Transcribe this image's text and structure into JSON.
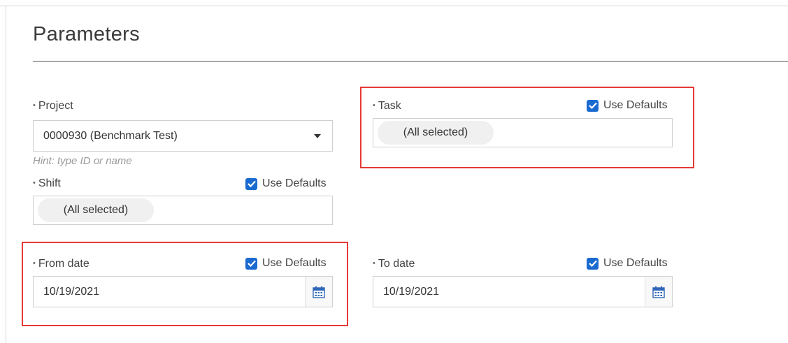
{
  "page": {
    "title": "Parameters"
  },
  "colors": {
    "accent": "#1b6ad0",
    "highlight": "#e53935",
    "rule": "#a9a9a9"
  },
  "icons": {
    "checkbox": "checkbox-checked-icon",
    "dropdown": "caret-down-icon",
    "calendar": "calendar-icon"
  },
  "form": {
    "required_marker": "•",
    "project": {
      "label": "Project",
      "value": "0000930 (Benchmark Test)",
      "hint": "Hint: type ID or name"
    },
    "task": {
      "label": "Task",
      "use_defaults": {
        "label": "Use Defaults",
        "checked": true
      },
      "chip": "(All selected)"
    },
    "shift": {
      "label": "Shift",
      "use_defaults": {
        "label": "Use Defaults",
        "checked": true
      },
      "chip": "(All selected)"
    },
    "from_date": {
      "label": "From date",
      "use_defaults": {
        "label": "Use Defaults",
        "checked": true
      },
      "value": "10/19/2021"
    },
    "to_date": {
      "label": "To date",
      "use_defaults": {
        "label": "Use Defaults",
        "checked": true
      },
      "value": "10/19/2021"
    }
  }
}
